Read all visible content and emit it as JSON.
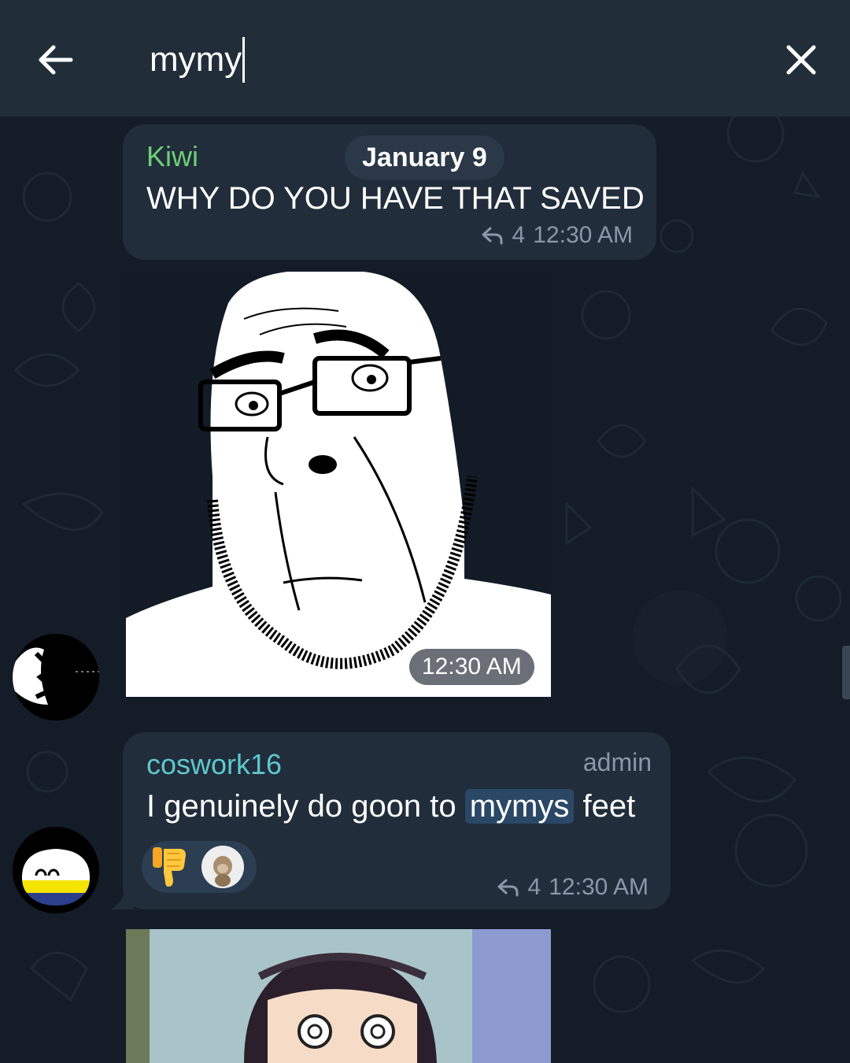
{
  "search": {
    "query": "mymy"
  },
  "messages": [
    {
      "sender": "Kiwi",
      "date_pill": "January 9",
      "text": "WHY DO YOU HAVE THAT SAVED",
      "reply_count": "4",
      "time": "12:30 AM"
    },
    {
      "type": "image",
      "time": "12:30 AM"
    },
    {
      "sender": "coswork16",
      "role": "admin",
      "text_before": "I genuinely do goon to ",
      "text_highlight": "mymys",
      "text_after": " feet",
      "reply_count": "4",
      "time": "12:30 AM",
      "reactions": [
        "thumbs-down",
        "monkey-avatar"
      ]
    }
  ],
  "colors": {
    "topbar": "#222d3a",
    "bubble": "#212d3b",
    "kiwi_name": "#6dcf74",
    "coswork_name": "#5fc7cc",
    "meta": "#8a98a8",
    "highlight": "#2a4866"
  },
  "icons": [
    "arrow-left-icon",
    "close-icon",
    "reply-icon",
    "thumbs-down-icon"
  ]
}
